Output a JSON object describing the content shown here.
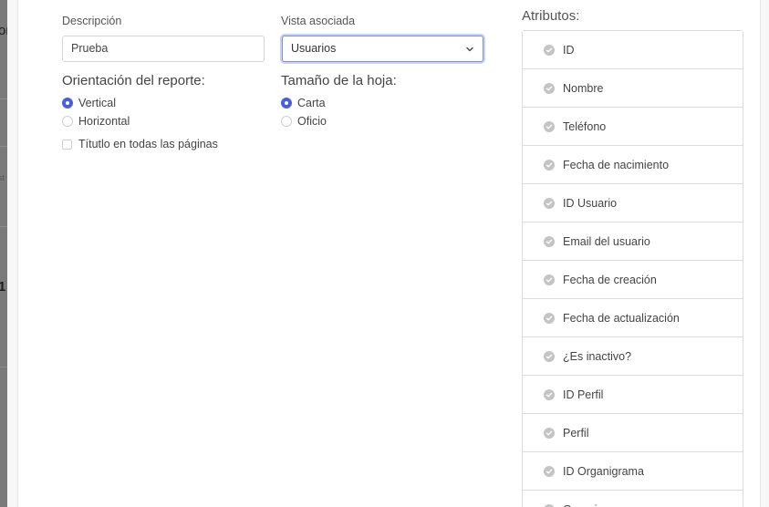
{
  "backdrop": {
    "fragments": [
      "or",
      "st",
      "1"
    ]
  },
  "form": {
    "descripcion_label": "Descripción",
    "descripcion_value": "Prueba",
    "vista_label": "Vista asociada",
    "vista_value": "Usuarios",
    "orientacion": {
      "title": "Orientación del reporte:",
      "options": [
        {
          "label": "Vertical",
          "checked": true
        },
        {
          "label": "Horizontal",
          "checked": false
        }
      ]
    },
    "titulo_checkbox_label": "Títutlo en todas las páginas",
    "tamano": {
      "title": "Tamaño de la hoja:",
      "options": [
        {
          "label": "Carta",
          "checked": true
        },
        {
          "label": "Oficio",
          "checked": false
        }
      ]
    }
  },
  "atributos": {
    "title": "Atributos:",
    "items": [
      "ID",
      "Nombre",
      "Teléfono",
      "Fecha de nacimiento",
      "ID Usuario",
      "Email del usuario",
      "Fecha de creación",
      "Fecha de actualización",
      "¿Es inactivo?",
      "ID Perfil",
      "Perfil",
      "ID Organigrama",
      "Organigrama"
    ]
  },
  "colors": {
    "accent": "#4a60d8",
    "check_icon": "#c4c4c4"
  }
}
